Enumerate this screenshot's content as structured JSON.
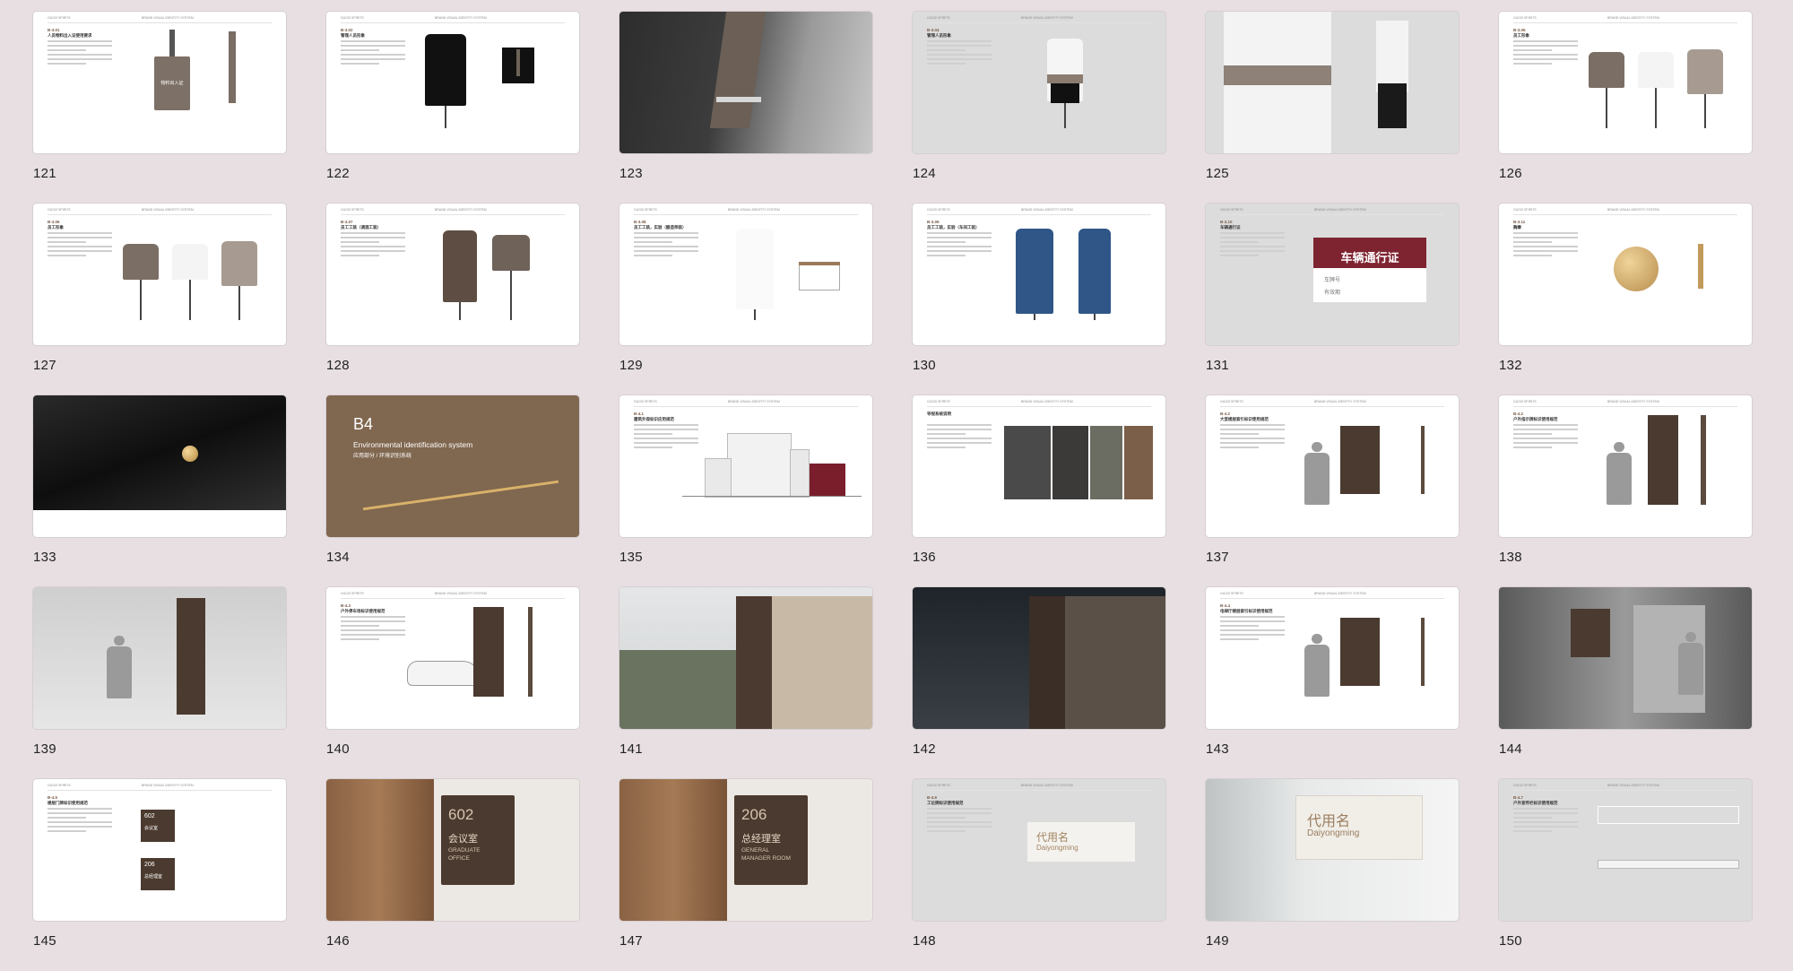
{
  "slides": [
    {
      "number": "121",
      "type": "badge",
      "header": [
        "GUOZI SPIRITS",
        "BRAND VISUAL IDENTITY SYSTEM"
      ],
      "section": "B-3.01",
      "title": "人员物料出入证使用要求",
      "badge_text": "物料出入证"
    },
    {
      "number": "122",
      "type": "suit",
      "header": [
        "GUOZI SPIRITS",
        "BRAND VISUAL IDENTITY SYSTEM"
      ],
      "section": "B-3.02",
      "title": "管理人员形象"
    },
    {
      "number": "123",
      "type": "photo-suit"
    },
    {
      "number": "124",
      "type": "blouse",
      "header": [
        "GUOZI SPIRITS",
        "BRAND VISUAL IDENTITY SYSTEM"
      ],
      "section": "B-3.04",
      "title": "管理人员形象"
    },
    {
      "number": "125",
      "type": "photo-blouse"
    },
    {
      "number": "126",
      "type": "shirts",
      "header": [
        "GUOZI SPIRITS",
        "BRAND VISUAL IDENTITY SYSTEM"
      ],
      "section": "B-3.05",
      "title": "员工形象"
    },
    {
      "number": "127",
      "type": "shirts",
      "header": [
        "GUOZI SPIRITS",
        "BRAND VISUAL IDENTITY SYSTEM"
      ],
      "section": "B-3.06",
      "title": "员工形象"
    },
    {
      "number": "128",
      "type": "apron",
      "header": [
        "GUOZI SPIRITS",
        "BRAND VISUAL IDENTITY SYSTEM"
      ],
      "section": "B-3.07",
      "title": "员工工装（调酒工装）"
    },
    {
      "number": "129",
      "type": "labcoat",
      "header": [
        "GUOZI SPIRITS",
        "BRAND VISUAL IDENTITY SYSTEM"
      ],
      "section": "B-3.08",
      "title": "员工工装，实验（酿造师装）"
    },
    {
      "number": "130",
      "type": "overalls",
      "header": [
        "GUOZI SPIRITS",
        "BRAND VISUAL IDENTITY SYSTEM"
      ],
      "section": "B-3.09",
      "title": "员工工装，实验（车间工装）"
    },
    {
      "number": "131",
      "type": "permit",
      "header": [
        "GUOZI SPIRITS",
        "BRAND VISUAL IDENTITY SYSTEM"
      ],
      "section": "B-3.10",
      "title": "车辆通行证",
      "permit_title": "车辆通行证",
      "field_1": "车牌号",
      "field_2": "有效期"
    },
    {
      "number": "132",
      "type": "pin",
      "header": [
        "GUOZI SPIRITS",
        "BRAND VISUAL IDENTITY SYSTEM"
      ],
      "section": "B-3.11",
      "title": "胸章"
    },
    {
      "number": "133",
      "type": "photo-pin"
    },
    {
      "number": "134",
      "type": "cover",
      "cover_code": "B4",
      "cover_en": "Environmental identification system",
      "cover_cn": "应用部分 / 环境识别系统"
    },
    {
      "number": "135",
      "type": "building",
      "header": [
        "GUOZI SPIRITS",
        "BRAND VISUAL IDENTITY SYSTEM"
      ],
      "section": "B-4.1",
      "title": "建筑外观标识应用规范"
    },
    {
      "number": "136",
      "type": "photos-signs",
      "header": [
        "GUOZI SPIRITS",
        "BRAND VISUAL IDENTITY SYSTEM"
      ],
      "title": "导视系统说明"
    },
    {
      "number": "137",
      "type": "wayfinding",
      "header": [
        "GUOZI SPIRITS",
        "BRAND VISUAL IDENTITY SYSTEM"
      ],
      "section": "B-4.2",
      "title": "大堂楼层索引标识使用规范"
    },
    {
      "number": "138",
      "type": "totem",
      "header": [
        "GUOZI SPIRITS",
        "BRAND VISUAL IDENTITY SYSTEM"
      ],
      "section": "B-4.2",
      "title": "户外指示牌标识使用规范"
    },
    {
      "number": "139",
      "type": "photo-totem"
    },
    {
      "number": "140",
      "type": "parking",
      "header": [
        "GUOZI SPIRITS",
        "BRAND VISUAL IDENTITY SYSTEM"
      ],
      "section": "B-4.3",
      "title": "户外停车场标识使用规范"
    },
    {
      "number": "141",
      "type": "photo-parking-day"
    },
    {
      "number": "142",
      "type": "photo-parking-night"
    },
    {
      "number": "143",
      "type": "wayfinding",
      "header": [
        "GUOZI SPIRITS",
        "BRAND VISUAL IDENTITY SYSTEM"
      ],
      "section": "B-4.4",
      "title": "电梯厅楼层索引标识使用规范"
    },
    {
      "number": "144",
      "type": "photo-elevator"
    },
    {
      "number": "145",
      "type": "doorplates",
      "header": [
        "GUOZI SPIRITS",
        "BRAND VISUAL IDENTITY SYSTEM"
      ],
      "section": "B-4.5",
      "title": "楼层门牌标识使用规范",
      "plate1_num": "602",
      "plate1_name": "会议室",
      "plate2_num": "206",
      "plate2_name": "总经理室"
    },
    {
      "number": "146",
      "type": "photo-door",
      "door_num": "602",
      "door_cn": "会议室",
      "door_en_1": "GRADUATE",
      "door_en_2": "OFFICE"
    },
    {
      "number": "147",
      "type": "photo-door",
      "door_num": "206",
      "door_cn": "总经理室",
      "door_en_1": "GENERAL",
      "door_en_2": "MANAGER ROOM"
    },
    {
      "number": "148",
      "type": "desk",
      "header": [
        "GUOZI SPIRITS",
        "BRAND VISUAL IDENTITY SYSTEM"
      ],
      "section": "B-4.6",
      "title": "工位牌标识使用规范",
      "name_cn": "代用名",
      "name_en": "Daiyongming"
    },
    {
      "number": "149",
      "type": "photo-desk",
      "name_cn": "代用名",
      "name_en": "Daiyongming"
    },
    {
      "number": "150",
      "type": "rail",
      "header": [
        "GUOZI SPIRITS",
        "BRAND VISUAL IDENTITY SYSTEM"
      ],
      "section": "B-4.7",
      "title": "户外宣传栏标识使用规范"
    }
  ],
  "colors": {
    "background": "#e7dfe1",
    "brand_brown": "#80674f",
    "sign_dark": "#4b3a2f",
    "permit_red": "#7e2430"
  }
}
